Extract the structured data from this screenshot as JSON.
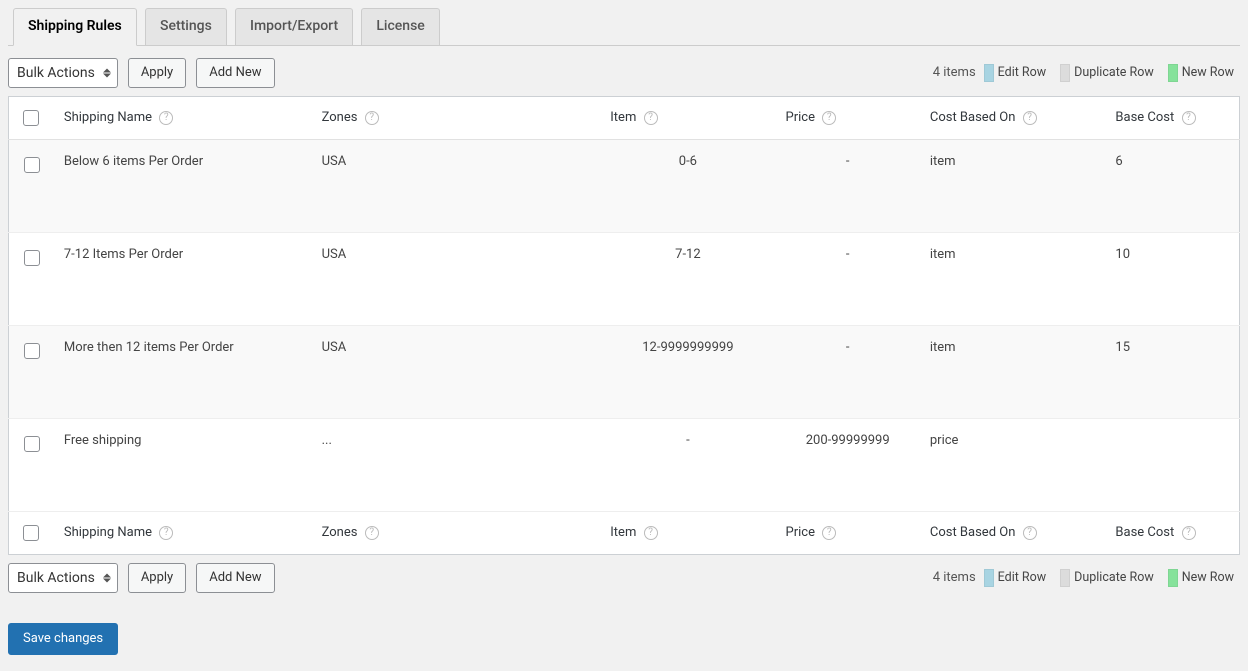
{
  "tabs": [
    {
      "label": "Shipping Rules",
      "active": true
    },
    {
      "label": "Settings"
    },
    {
      "label": "Import/Export"
    },
    {
      "label": "License"
    }
  ],
  "bulk_select": "Bulk Actions",
  "apply_label": "Apply",
  "add_new_label": "Add New",
  "items_count": "4 items",
  "legend": {
    "edit": "Edit Row",
    "duplicate": "Duplicate Row",
    "new": "New Row"
  },
  "columns": {
    "shipping_name": "Shipping Name",
    "zones": "Zones",
    "item": "Item",
    "price": "Price",
    "cost_based_on": "Cost Based On",
    "base_cost": "Base Cost"
  },
  "rows": [
    {
      "name": "Below 6 items Per Order",
      "zones": "USA",
      "item": "0-6",
      "price": "-",
      "cost": "item",
      "base": "6"
    },
    {
      "name": "7-12 Items Per Order",
      "zones": "USA",
      "item": "7-12",
      "price": "-",
      "cost": "item",
      "base": "10"
    },
    {
      "name": "More then 12 items Per Order",
      "zones": "USA",
      "item": "12-9999999999",
      "price": "-",
      "cost": "item",
      "base": "15"
    },
    {
      "name": "Free shipping",
      "zones": "...",
      "item": "-",
      "price": "200-99999999",
      "cost": "price",
      "base": ""
    }
  ],
  "save_label": "Save changes"
}
